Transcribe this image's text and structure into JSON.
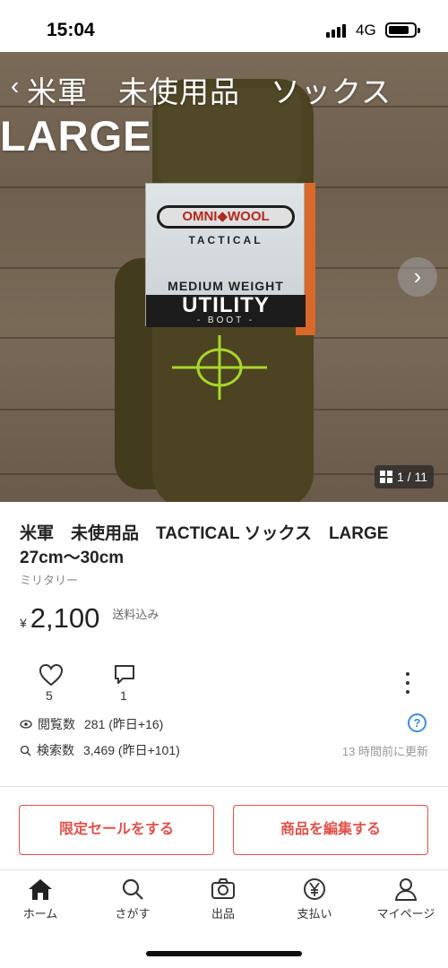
{
  "status_bar": {
    "time": "15:04",
    "network": "4G"
  },
  "hero": {
    "overlay_title": "米軍　未使用品　ソックス",
    "overlay_title_2": "LARGE",
    "image_counter": "1 / 11",
    "label": {
      "brand": "OMNI◆WOOL",
      "line1": "TACTICAL",
      "line2": "MEDIUM WEIGHT",
      "line3": "UTILITY",
      "line4": "- BOOT -"
    }
  },
  "product": {
    "title": "米軍　未使用品　TACTICAL ソックス　LARGE 27cm～30cm",
    "category": "ミリタリー",
    "currency": "¥",
    "price": "2,100",
    "shipping": "送料込み"
  },
  "engagement": {
    "likes": "5",
    "comments": "1"
  },
  "stats": {
    "views_label": "閲覧数",
    "views": "281 (昨日+16)",
    "searches_label": "検索数",
    "searches": "3,469 (昨日+101)",
    "updated": "13 時間前に更新",
    "help": "?"
  },
  "actions": {
    "sale_label": "限定セールをする",
    "edit_label": "商品を編集する"
  },
  "tabbar": {
    "items": [
      {
        "label": "ホーム",
        "icon": "home-icon"
      },
      {
        "label": "さがす",
        "icon": "search-icon"
      },
      {
        "label": "出品",
        "icon": "camera-icon"
      },
      {
        "label": "支払い",
        "icon": "yen-icon"
      },
      {
        "label": "マイページ",
        "icon": "user-icon"
      }
    ]
  },
  "colors": {
    "accent": "#e0514a",
    "help_blue": "#3c8ae0"
  }
}
